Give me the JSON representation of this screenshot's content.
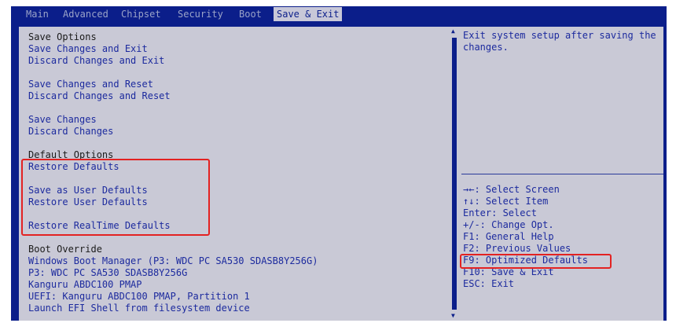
{
  "tabs": [
    "Main",
    "Advanced",
    "Chipset",
    "Security",
    "Boot",
    "Save & Exit"
  ],
  "active_tab": "Save & Exit",
  "sections": {
    "save_options_header": "Save Options",
    "save_items": [
      "Save Changes and Exit",
      "Discard Changes and Exit"
    ],
    "reset_items": [
      "Save Changes and Reset",
      "Discard Changes and Reset"
    ],
    "change_items": [
      "Save Changes",
      "Discard Changes"
    ],
    "default_options_header": "Default Options",
    "default_items": [
      "Restore Defaults",
      "Save as User Defaults",
      "Restore User Defaults",
      "Restore RealTime Defaults"
    ],
    "boot_override_header": "Boot Override",
    "boot_items": [
      "Windows Boot Manager (P3: WDC PC SA530 SDASB8Y256G)",
      "P3: WDC PC SA530 SDASB8Y256G",
      "Kanguru ABDC100 PMAP",
      "UEFI: Kanguru ABDC100 PMAP, Partition 1",
      "Launch EFI Shell from filesystem device"
    ]
  },
  "help_text": "Exit system setup after saving the changes.",
  "key_help": [
    "→←: Select Screen",
    "↑↓: Select Item",
    "Enter: Select",
    "+/-: Change Opt.",
    "F1: General Help",
    "F2: Previous Values",
    "F9: Optimized Defaults",
    "F10: Save & Exit",
    "ESC: Exit"
  ],
  "colors": {
    "bios_blue": "#0b1e8a",
    "panel_gray": "#c9c9d6",
    "item_text": "#1c2a9e",
    "highlight_box": "#e32222"
  }
}
